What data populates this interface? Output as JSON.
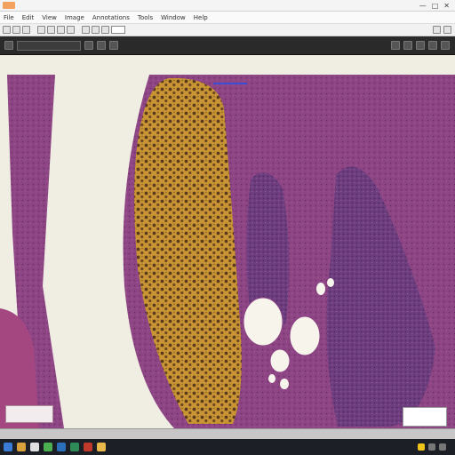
{
  "window": {
    "title": "",
    "controls": [
      "—",
      "□",
      "✕"
    ]
  },
  "menu": {
    "items": [
      "File",
      "Edit",
      "View",
      "Image",
      "Annotations",
      "Tools",
      "Window",
      "Help"
    ]
  },
  "toolbar": {
    "center_label": ""
  },
  "viewer": {
    "slide_field": "",
    "center_label": ""
  },
  "status": {
    "left_text": "",
    "zoom_text": ""
  },
  "taskbar": {
    "clock": ""
  },
  "colors": {
    "tissue": "#8a3e82",
    "stain_brown": "#b8862d",
    "background": "#f0eee3",
    "dark_bar": "#2a2a2a"
  },
  "icons": [
    "app-logo-icon",
    "minimize-icon",
    "maximize-icon",
    "close-icon",
    "zoom-in-icon",
    "zoom-out-icon",
    "pan-icon",
    "annotation-icon",
    "start-icon"
  ]
}
